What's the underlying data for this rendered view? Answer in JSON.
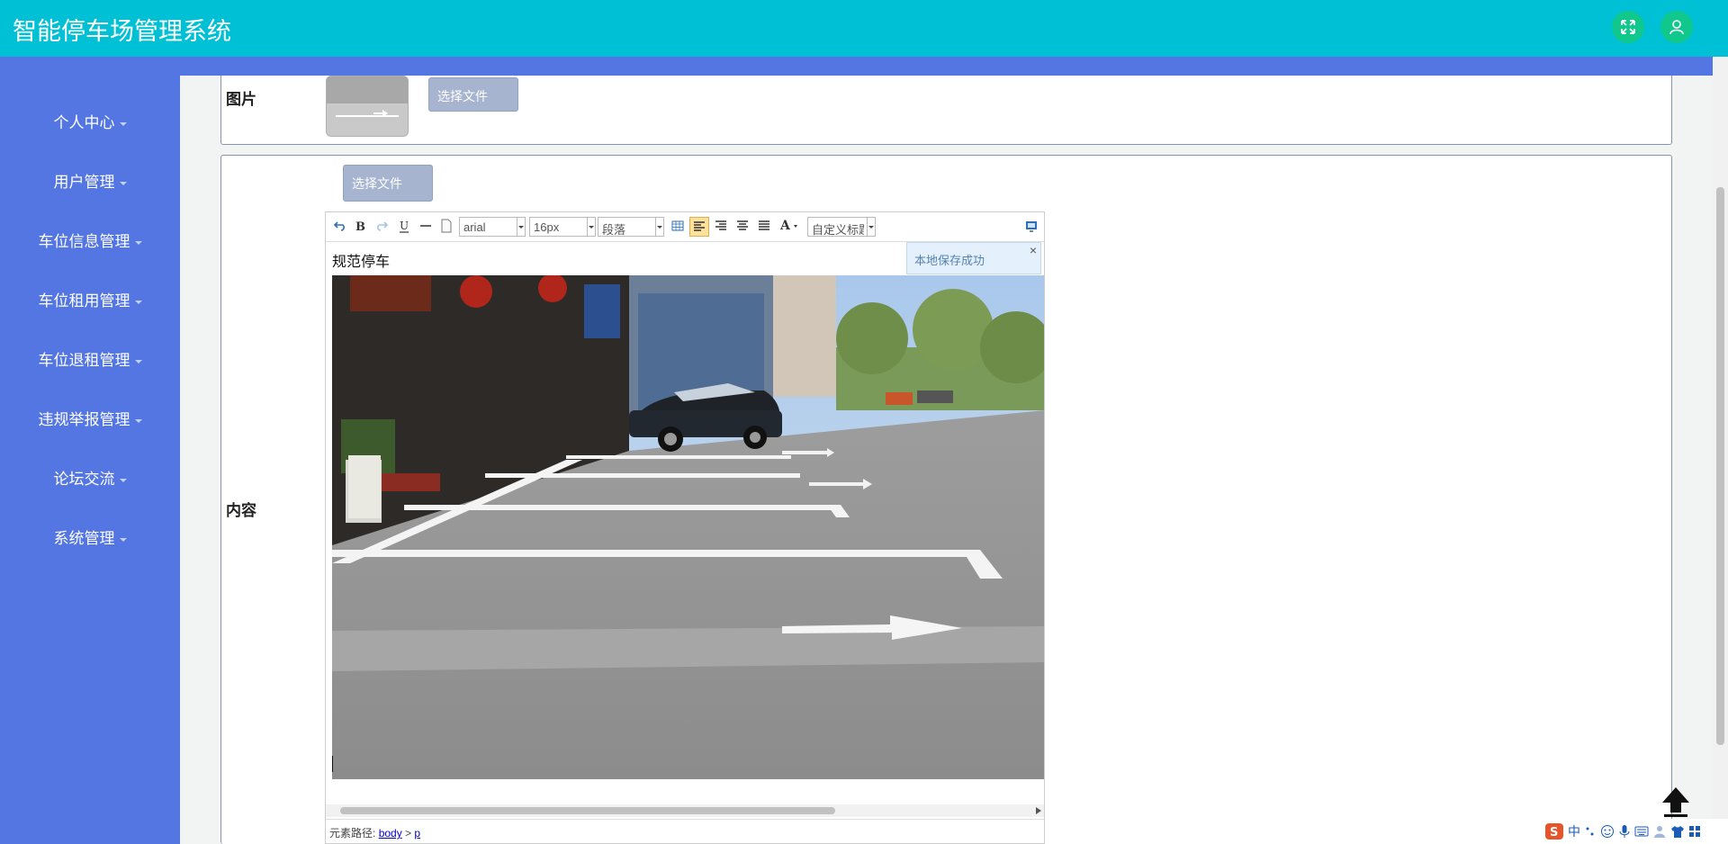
{
  "app": {
    "title": "智能停车场管理系统"
  },
  "header": {
    "fullscreen_icon": "expand-arrows-icon",
    "user_icon": "user-icon"
  },
  "sidebar": {
    "items": [
      {
        "label": "个人中心"
      },
      {
        "label": "用户管理"
      },
      {
        "label": "车位信息管理"
      },
      {
        "label": "车位租用管理"
      },
      {
        "label": "车位退租管理"
      },
      {
        "label": "违规举报管理"
      },
      {
        "label": "论坛交流"
      },
      {
        "label": "系统管理"
      }
    ]
  },
  "form": {
    "image_label": "图片",
    "image_button": "选择文件",
    "content_label": "内容",
    "content_button": "选择文件"
  },
  "editor": {
    "font_family": "arial",
    "font_size": "16px",
    "paragraph": "段落",
    "custom_title": "自定义标题",
    "paragraph_text": "规范停车",
    "toast": "本地保存成功",
    "toast_close": "×",
    "path_label": "元素路径:",
    "path_body": "body",
    "path_sep": ">",
    "path_p": "p"
  },
  "ime": {
    "text": "中"
  },
  "colors": {
    "header": "#00c0d6",
    "sidebar": "#5476e3",
    "accent_button": "#10c88c"
  }
}
